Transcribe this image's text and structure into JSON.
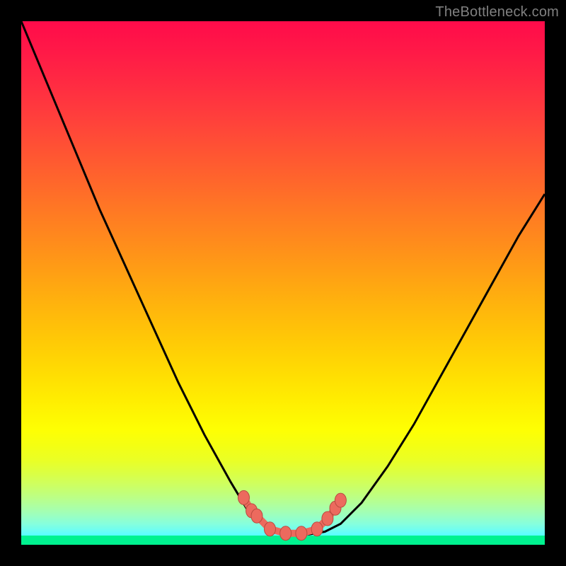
{
  "attribution": "TheBottleneck.com",
  "chart_data": {
    "type": "line",
    "title": "",
    "xlabel": "",
    "ylabel": "",
    "xlim": [
      0,
      1
    ],
    "ylim": [
      0,
      1
    ],
    "series": [
      {
        "name": "bottleneck-curve",
        "x": [
          0.0,
          0.05,
          0.1,
          0.15,
          0.2,
          0.25,
          0.3,
          0.35,
          0.4,
          0.43,
          0.46,
          0.49,
          0.52,
          0.55,
          0.58,
          0.61,
          0.65,
          0.7,
          0.75,
          0.8,
          0.85,
          0.9,
          0.95,
          1.0
        ],
        "y": [
          1.0,
          0.88,
          0.76,
          0.64,
          0.53,
          0.42,
          0.31,
          0.21,
          0.12,
          0.07,
          0.04,
          0.025,
          0.02,
          0.02,
          0.025,
          0.04,
          0.08,
          0.15,
          0.23,
          0.32,
          0.41,
          0.5,
          0.59,
          0.67
        ]
      }
    ],
    "markers": {
      "name": "bottleneck-markers",
      "x": [
        0.425,
        0.44,
        0.45,
        0.475,
        0.505,
        0.535,
        0.565,
        0.585,
        0.6,
        0.61
      ],
      "y": [
        0.09,
        0.065,
        0.055,
        0.03,
        0.022,
        0.022,
        0.03,
        0.05,
        0.07,
        0.085
      ]
    },
    "green_band": {
      "y0": 0.0,
      "y1": 0.018
    },
    "colors": {
      "curve": "#000000",
      "markers_fill": "#ec6a5e",
      "markers_stroke": "#b94a3f",
      "green_band": "#00f28f"
    }
  }
}
